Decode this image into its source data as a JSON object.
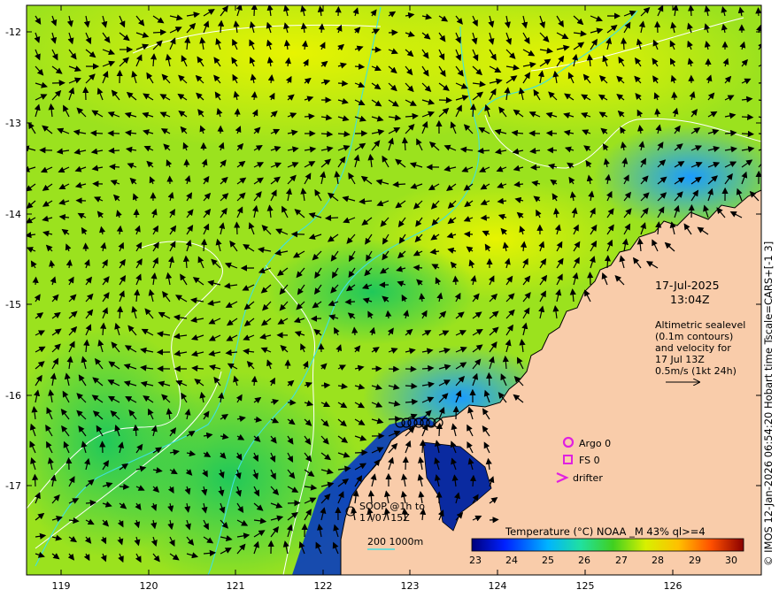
{
  "map": {
    "lat_ticks": [
      "-12",
      "-13",
      "-14",
      "-15",
      "-16",
      "-17"
    ],
    "lon_ticks": [
      "119",
      "120",
      "121",
      "122",
      "123",
      "124",
      "125",
      "126"
    ]
  },
  "info": {
    "date": "17-Jul-2025",
    "time": "13:04Z",
    "altimetry_lines": [
      "Altimetric sealevel",
      "(0.1m contours)",
      "and velocity for",
      "17 Jul 13Z",
      "0.5m/s (1kt 24h)"
    ]
  },
  "legend": {
    "argo": "Argo 0",
    "fs": "FS 0",
    "drifter": "drifter",
    "soop_lines": [
      "SOOP @1h to",
      "17/07 15Z"
    ],
    "depth": "200  1000m"
  },
  "colorbar": {
    "title": "Temperature (°C) NOAA _M 43% ql>=4",
    "ticks": [
      "23",
      "24",
      "25",
      "26",
      "27",
      "28",
      "29",
      "30"
    ]
  },
  "sidebar_text": "© IMOS 12-Jan-2026 06:54:20 Hobart time Tscale=CARS+[-1 3]",
  "colors": {
    "land": "#f9ccaa",
    "argo_marker": "#e020e0",
    "bathymetry_contour": "#40e0e0",
    "sealevel_contour": "#ffffff"
  }
}
